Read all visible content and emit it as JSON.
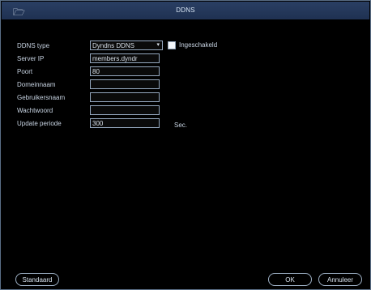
{
  "window": {
    "title": "DDNS",
    "logo": "🗁"
  },
  "form": {
    "ddns_type_label": "DDNS type",
    "ddns_type_value": "Dyndns DDNS",
    "enabled_label": "Ingeschakeld",
    "server_ip_label": "Server IP",
    "server_ip_value": "members.dyndr",
    "port_label": "Poort",
    "port_value": "80",
    "domain_label": "Domeinnaam",
    "domain_value": "",
    "username_label": "Gebruikersnaam",
    "username_value": "",
    "password_label": "Wachtwoord",
    "password_value": "",
    "update_label": "Update periode",
    "update_value": "300",
    "update_unit": "Sec."
  },
  "buttons": {
    "default": "Standaard",
    "ok": "OK",
    "cancel": "Annuleer"
  }
}
